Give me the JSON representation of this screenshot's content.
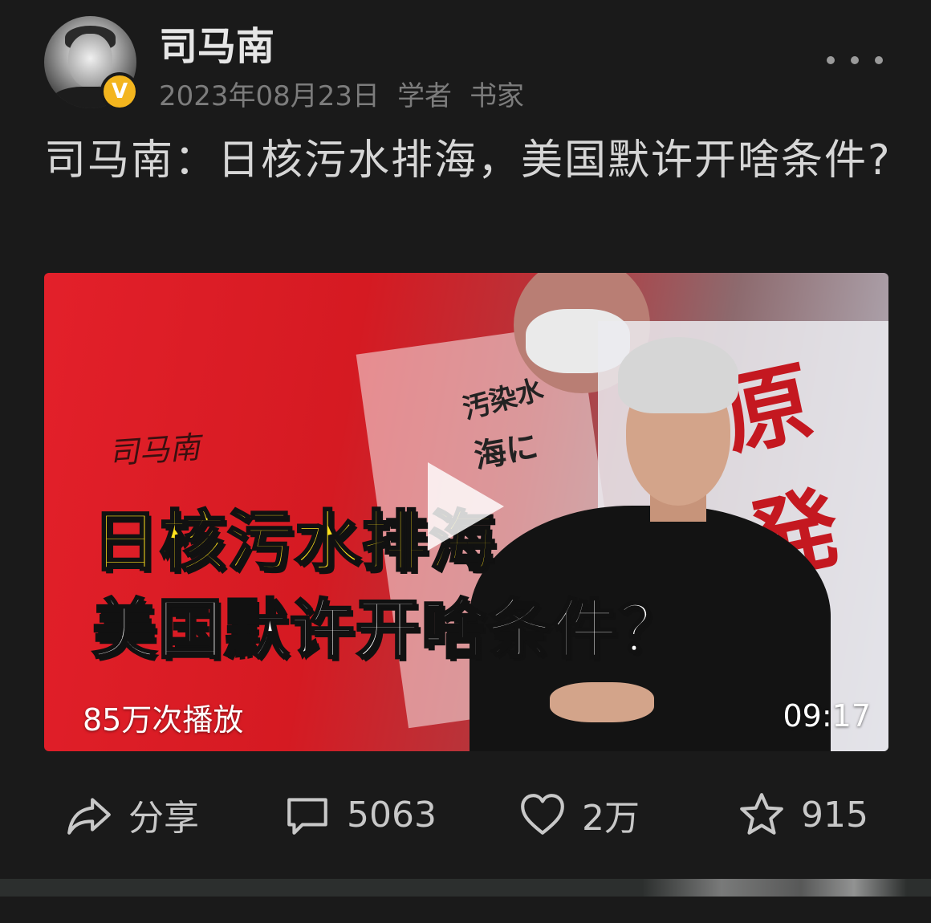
{
  "author": {
    "name": "司马南",
    "date": "2023年08月23日",
    "tags": [
      "学者",
      "书家"
    ],
    "verified_mark": "V"
  },
  "post": {
    "title": "司马南：日核污水排海，美国默许开啥条件?"
  },
  "video": {
    "thumbnail_line1": "日核污水排海",
    "thumbnail_line2": "美国默许开啥条件？",
    "signature": "司马南",
    "play_count": "85万次播放",
    "duration": "09:17",
    "sign_text_1": "原発",
    "sign_text_2": "汚染水",
    "sign_text_3": "海に"
  },
  "actions": {
    "share_label": "分享",
    "comment_count": "5063",
    "like_count": "2万",
    "favorite_count": "915"
  },
  "icons": [
    "more-icon",
    "share-icon",
    "comment-icon",
    "like-icon",
    "favorite-icon",
    "play-icon",
    "verified-icon"
  ],
  "colors": {
    "background": "#1a1a1a",
    "verified": "#f3b51e",
    "thumbnail_red": "#e3202a",
    "thumbnail_yellow": "#ffe21c"
  }
}
